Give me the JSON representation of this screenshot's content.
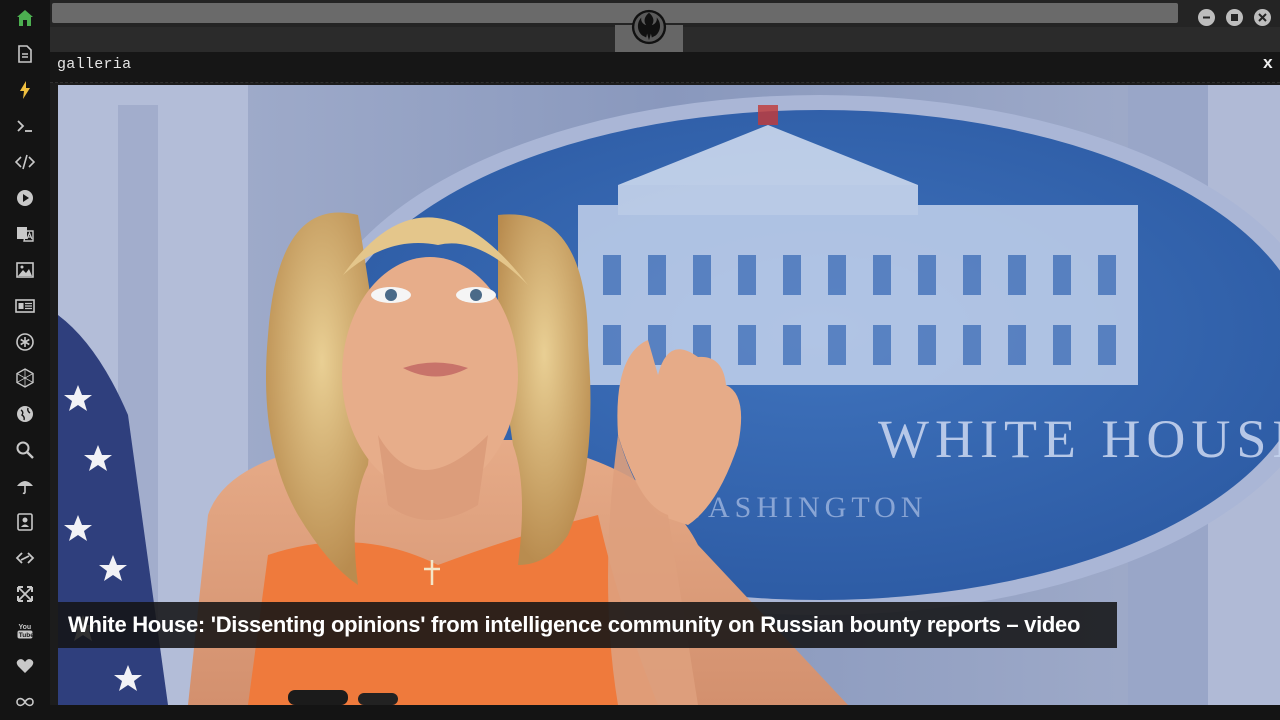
{
  "panel": {
    "title": "galleria",
    "close_label": "x"
  },
  "gallery": {
    "caption": "White House: 'Dissenting opinions' from intelligence community on Russian bounty reports – video",
    "background_sign_text": "WHITE HOUSE",
    "background_sign_subtext": "WASHINGTON"
  },
  "sidebar": {
    "items": [
      {
        "icon": "home-icon",
        "active": true
      },
      {
        "icon": "document-icon"
      },
      {
        "icon": "lightning-icon"
      },
      {
        "icon": "terminal-icon"
      },
      {
        "icon": "code-icon"
      },
      {
        "icon": "play-icon"
      },
      {
        "icon": "translate-icon"
      },
      {
        "icon": "image-icon"
      },
      {
        "icon": "news-icon"
      },
      {
        "icon": "asterisk-icon"
      },
      {
        "icon": "hexagon-icon"
      },
      {
        "icon": "globe-icon"
      },
      {
        "icon": "search-icon"
      },
      {
        "icon": "umbrella-icon"
      },
      {
        "icon": "contact-card-icon"
      },
      {
        "icon": "link-diamond-icon"
      },
      {
        "icon": "expand-icon"
      },
      {
        "icon": "youtube-icon"
      },
      {
        "icon": "heart-icon"
      },
      {
        "icon": "infinity-icon"
      }
    ]
  },
  "colors": {
    "sidebar_bg": "#141414",
    "icon": "#c8c8c8",
    "active_icon": "#4caf50",
    "caption_bg": "#141416"
  }
}
